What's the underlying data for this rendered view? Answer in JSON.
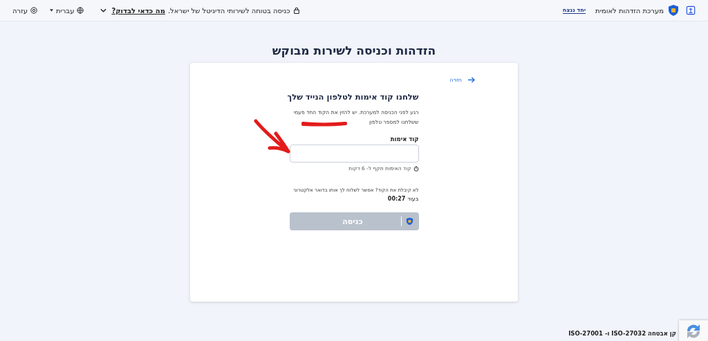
{
  "header": {
    "brand": "מערכת הזדהות לאומית",
    "badge": "יחד ננצח",
    "secure_notice": "כניסה בטוחה לשירותי הדיגיטל של ישראל.",
    "check_link": "מה כדאי לבדוק?",
    "language": "עברית",
    "help": "עזרה"
  },
  "page_title": "הזדהות וכניסה לשירות מבוקש",
  "card": {
    "back": "חזרה",
    "title": "שלחנו קוד אימות לטלפון הנייד שלך",
    "description": [
      "רגע לפני הכניסה למערכת. יש להזין את הקוד החד פעמי",
      "ששלחנו למספר טלפון"
    ],
    "field": {
      "label": "קוד אימות"
    },
    "hint": "קוד האימות תקף ל- 6 דקות",
    "resend": {
      "text": "לא קיבלת את הקוד? אפשר לשלוח לך אותו בדואר אלקטרוני",
      "prefix": "בעוד",
      "countdown": "00:27"
    },
    "submit": {
      "label": "כניסה",
      "disabled": true
    }
  },
  "footer": {
    "certification": "קן אבטחה ISO-27032 ו- ISO-27001"
  }
}
